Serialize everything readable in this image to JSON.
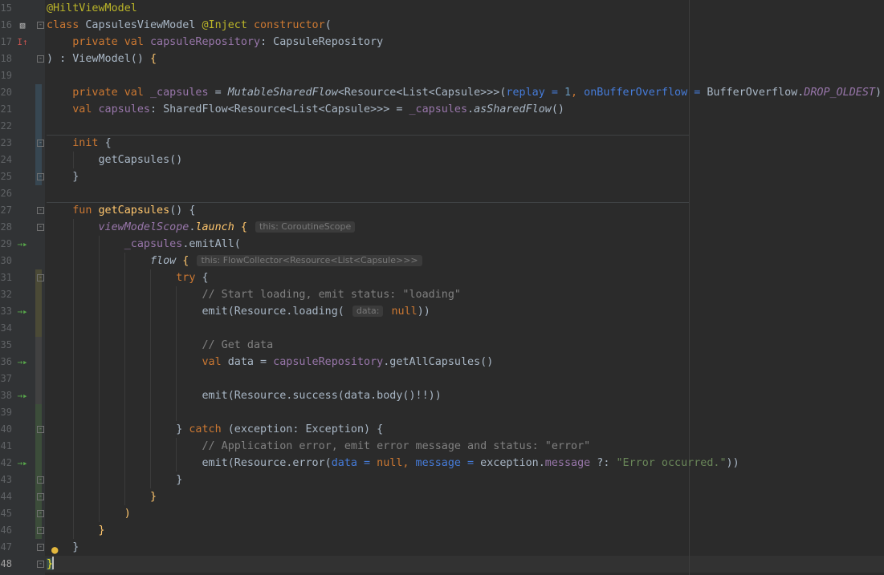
{
  "editor": {
    "colors": {
      "background": "#2b2b2b",
      "gutter": "#313335",
      "keyword": "#cc7832",
      "annotation": "#bbb529",
      "property": "#9876aa",
      "string": "#6a8759",
      "number": "#6897bb",
      "comment": "#808080",
      "function_decl": "#ffc66d",
      "named_arg": "#467cda"
    },
    "line_numbers": [
      "15",
      "16",
      "17",
      "18",
      "19",
      "20",
      "21",
      "22",
      "23",
      "24",
      "25",
      "26",
      "27",
      "28",
      "29",
      "30",
      "31",
      "32",
      "33",
      "34",
      "35",
      "36",
      "37",
      "38",
      "39",
      "40",
      "41",
      "42",
      "43",
      "44",
      "45",
      "46",
      "47",
      "48"
    ],
    "gutter_icons": {
      "line16": "hierarchy-icon",
      "line17": "override-icon",
      "suspend": "suspend-call-icon",
      "line47": "lightbulb-icon"
    },
    "tokens": {
      "l15_ann": "@HiltViewModel",
      "l16_class": "class ",
      "l16_name": "CapsulesViewModel ",
      "l16_inject": "@Inject ",
      "l16_ctor": "constructor",
      "l16_paren": "(",
      "l17_private": "private ",
      "l17_val": "val ",
      "l17_prop": "capsuleRepository",
      "l17_type": ": CapsuleRepository",
      "l18_close": ") : ViewModel() ",
      "l18_brace": "{",
      "l20_private": "private ",
      "l20_val": "val ",
      "l20_prop": "_capsules",
      "l20_eq": " = ",
      "l20_fn": "MutableSharedFlow",
      "l20_generic": "<Resource<List<Capsule>>>(",
      "l20_replay": "replay = ",
      "l20_one": "1",
      "l20_comma": ", ",
      "l20_overflow": "onBufferOverflow = ",
      "l20_enum": "BufferOverflow.",
      "l20_drop": "DROP_OLDEST",
      "l20_end": ")",
      "l21_val": "val ",
      "l21_prop": "capsules",
      "l21_type": ": SharedFlow<Resource<List<Capsule>>> = ",
      "l21_prop2": "_capsules",
      "l21_dot": ".",
      "l21_fn": "asSharedFlow",
      "l21_end": "()",
      "l23_init": "init ",
      "l23_brace": "{",
      "l24_call": "getCapsules()",
      "l25_brace": "}",
      "l27_fun": "fun ",
      "l27_name": "getCapsules",
      "l27_rest": "() {",
      "l28_scope": "viewModelScope",
      "l28_dot": ".",
      "l28_launch": "launch",
      "l28_brace": " {",
      "l28_hint": "this: CoroutineScope",
      "l29_prop": "_capsules",
      "l29_rest": ".emitAll(",
      "l30_flow": "flow",
      "l30_brace": " {",
      "l30_hint": "this: FlowCollector<Resource<List<Capsule>>>",
      "l31_try": "try ",
      "l31_brace": "{",
      "l32_comment": "// Start loading, emit status: \"loading\"",
      "l33_a": "emit(Resource.loading(",
      "l33_hint": "data:",
      "l33_null": "null",
      "l33_end": "))",
      "l35_comment": "// Get data",
      "l36_val": "val ",
      "l36_a": "data = ",
      "l36_prop": "capsuleRepository",
      "l36_b": ".getAllCapsules()",
      "l38_a": "emit(Resource.success(data.body()!!))",
      "l40_a": "} ",
      "l40_catch": "catch ",
      "l40_b": "(exception: Exception) {",
      "l41_comment": "// Application error, emit error message and status: \"error\"",
      "l42_a": "emit(Resource.error(",
      "l42_data": "data = ",
      "l42_null": "null",
      "l42_comma": ", ",
      "l42_msg": "message = ",
      "l42_b": "exception.",
      "l42_prop": "message",
      "l42_elvis": " ?: ",
      "l42_str": "\"Error occurred.\"",
      "l42_end": "))",
      "l43_brace": "}",
      "l44_brace": "}",
      "l45_paren": ")",
      "l46_brace": "}",
      "l47_brace": "}",
      "l48_brace": "}"
    }
  }
}
